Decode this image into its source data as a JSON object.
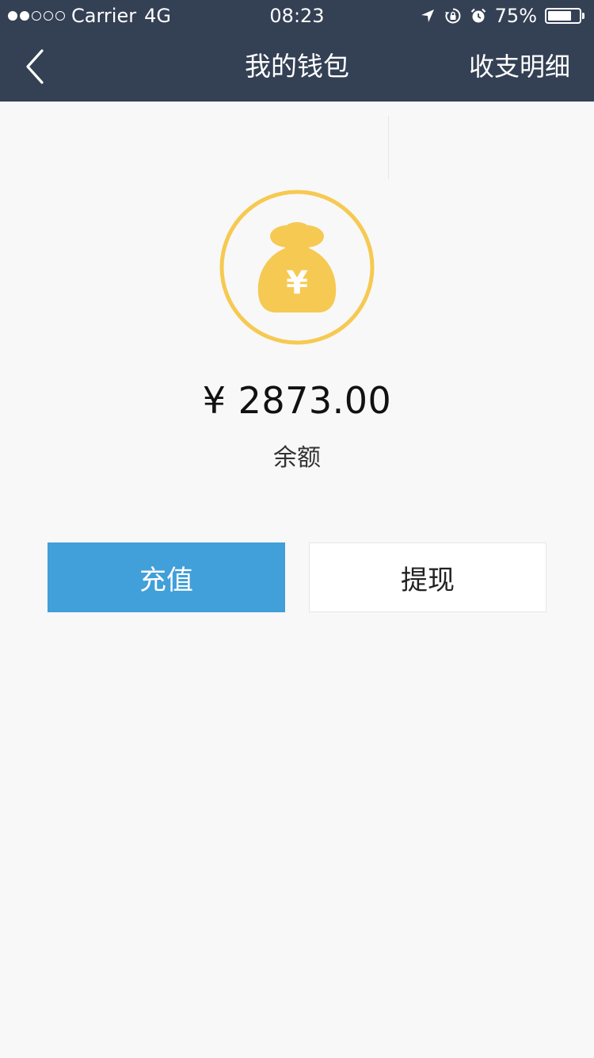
{
  "status_bar": {
    "carrier": "Carrier",
    "network": "4G",
    "time": "08:23",
    "battery": "75%",
    "battery_level": 0.75,
    "signal_dots_filled": 2,
    "signal_dots_total": 5,
    "icons": [
      "location-icon",
      "orientation-lock-icon",
      "alarm-icon",
      "battery-icon"
    ]
  },
  "nav": {
    "title": "我的钱包",
    "action": "收支明细",
    "back_icon": "chevron-left-icon"
  },
  "wallet": {
    "icon": "money-bag-icon",
    "icon_symbol": "¥",
    "amount": "¥ 2873.00",
    "amount_label": "余额"
  },
  "buttons": {
    "recharge": "充值",
    "withdraw": "提现"
  },
  "colors": {
    "header": "#344054",
    "background": "#f8f8f8",
    "accent_gold": "#f6c952",
    "recharge_blue": "#419fd9"
  }
}
